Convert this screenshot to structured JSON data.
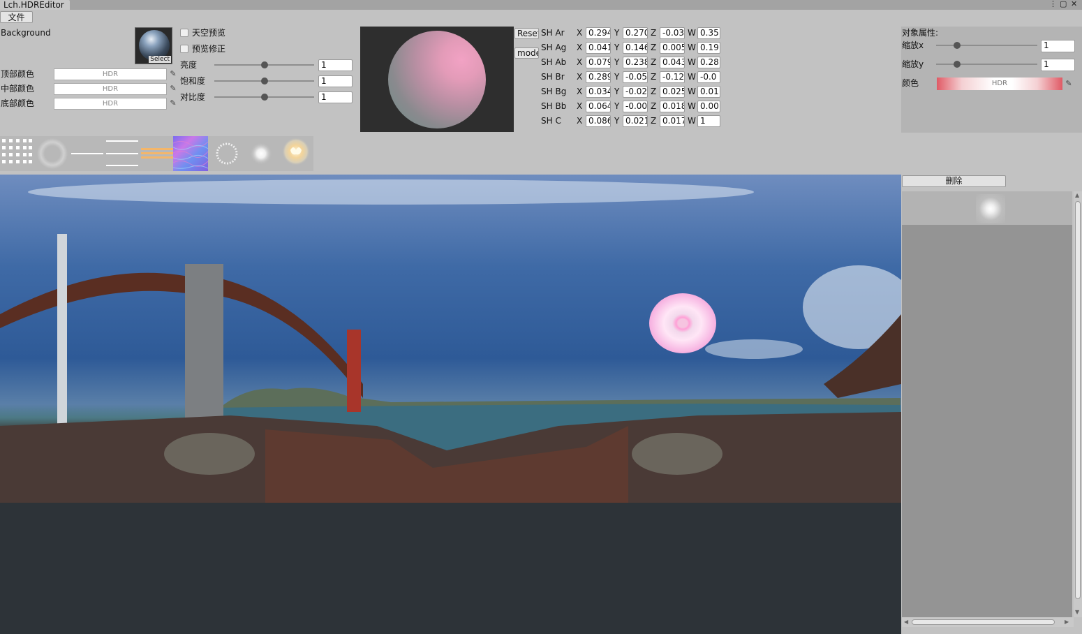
{
  "window": {
    "title": "Lch.HDREditor",
    "controls": [
      "⋮",
      "▢",
      "✕"
    ]
  },
  "menu": {
    "file": "文件"
  },
  "background": {
    "label": "Background",
    "select_label": "Select"
  },
  "colors": [
    {
      "label": "顶部颜色",
      "value": "HDR"
    },
    {
      "label": "中部颜色",
      "value": "HDR"
    },
    {
      "label": "底部颜色",
      "value": "HDR"
    }
  ],
  "toggles": {
    "sky_preview": "天空预览",
    "preview_fix": "预览修正"
  },
  "sliders": [
    {
      "label": "亮度",
      "value": "1",
      "level": 0.5
    },
    {
      "label": "饱和度",
      "value": "1",
      "level": 0.5
    },
    {
      "label": "对比度",
      "value": "1",
      "level": 0.5
    }
  ],
  "buttons": {
    "reset": "Reset",
    "mode": "mode"
  },
  "sh": {
    "axis_labels": [
      "X",
      "Y",
      "Z",
      "W"
    ],
    "rows": [
      {
        "name": "SH Ar",
        "x": "0.294",
        "y": "0.270",
        "z": "-0.03",
        "w": "0.35"
      },
      {
        "name": "SH Ag",
        "x": "0.041",
        "y": "0.146",
        "z": "0.005",
        "w": "0.19"
      },
      {
        "name": "SH Ab",
        "x": "0.079",
        "y": "0.238",
        "z": "0.043",
        "w": "0.28"
      },
      {
        "name": "SH Br",
        "x": "0.289",
        "y": "-0.05",
        "z": "-0.12",
        "w": "-0.0"
      },
      {
        "name": "SH Bg",
        "x": "0.034",
        "y": "-0.02",
        "z": "0.025",
        "w": "0.01"
      },
      {
        "name": "SH Bb",
        "x": "0.064",
        "y": "-0.00",
        "z": "0.018",
        "w": "0.00"
      },
      {
        "name": "SH C",
        "x": "0.086",
        "y": "0.021",
        "z": "0.017",
        "w": "1"
      }
    ]
  },
  "object_props": {
    "title": "对象属性:",
    "scale_x_label": "缩放x",
    "scale_x": "1",
    "scale_x_level": 0.2,
    "scale_y_label": "缩放y",
    "scale_y": "1",
    "scale_y_level": 0.2,
    "color_label": "颜色",
    "color_value": "HDR"
  },
  "right_panel": {
    "delete_label": "删除"
  },
  "textures": [
    "dots-texture",
    "ring-blur-texture",
    "line-texture",
    "triple-line-texture",
    "orange-stripes-texture",
    "normal-map-texture",
    "ring-texture",
    "soft-glow-texture",
    "flower-glow-texture"
  ]
}
